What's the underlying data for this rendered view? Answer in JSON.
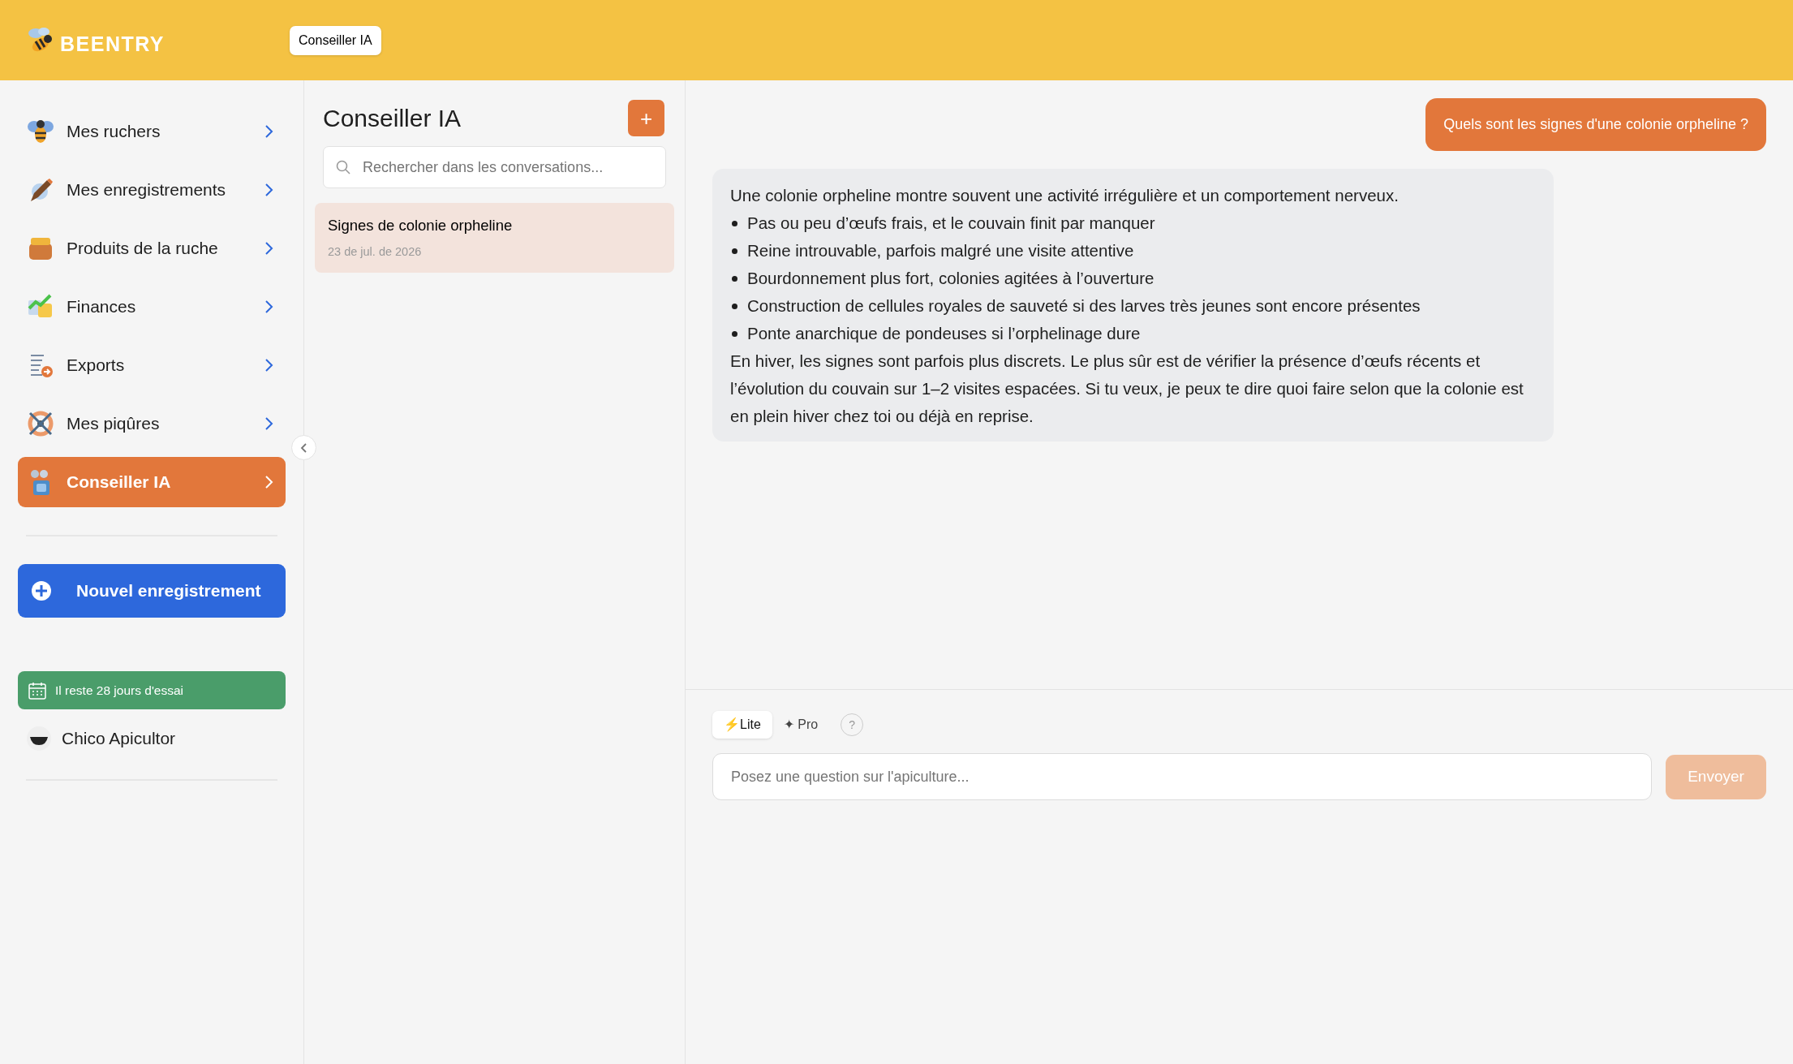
{
  "header": {
    "brand": "BEENTRY",
    "page_pill": "Conseiller IA"
  },
  "sidebar": {
    "items": [
      {
        "label": "Mes ruchers",
        "selected": false
      },
      {
        "label": "Mes enregistrements",
        "selected": false
      },
      {
        "label": "Produits de la ruche",
        "selected": false
      },
      {
        "label": "Finances",
        "selected": false
      },
      {
        "label": "Exports",
        "selected": false
      },
      {
        "label": "Mes piqûres",
        "selected": false
      },
      {
        "label": "Conseiller IA",
        "selected": true
      }
    ],
    "new_button": "Nouvel enregistrement",
    "trial": "Il reste 28 jours d'essai",
    "user": "Chico Apicultor"
  },
  "conversations": {
    "title": "Conseiller IA",
    "add_button": "+",
    "search": {
      "placeholder": "Rechercher dans les conversations..."
    },
    "items": [
      {
        "title": "Signes de colonie orpheline",
        "date": "23 de jul. de 2026",
        "selected": true
      }
    ]
  },
  "chat": {
    "messages": [
      {
        "kind": "user",
        "text": "Quels sont les signes d'une colonie orpheline ?"
      },
      {
        "kind": "assistant",
        "intro": "Une colonie orpheline montre souvent une activité irrégulière et un comportement nerveux.",
        "bullets": [
          "Pas ou peu d’œufs frais, et le couvain finit par manquer",
          "Reine introuvable, parfois malgré une visite attentive",
          "Bourdonnement plus fort, colonies agitées à l’ouverture",
          "Construction de cellules royales de sauveté si des larves très jeunes sont encore présentes",
          "Ponte anarchique de pondeuses si l’orphelinage dure"
        ],
        "outro": "En hiver, les signes sont parfois plus discrets. Le plus sûr est de vérifier la présence d’œufs récents et l’évolution du couvain sur 1–2 visites espacées. Si tu veux, je peux te dire quoi faire selon que la colonie est en plein hiver chez toi ou déjà en reprise."
      }
    ],
    "modes": [
      {
        "label": "⚡Lite",
        "selected": true
      },
      {
        "label": "✦ Pro",
        "selected": false
      }
    ],
    "help": "?",
    "input": {
      "placeholder": "Posez une question sur l'apiculture..."
    },
    "send": {
      "label": "Envoyer",
      "disabled": true
    }
  }
}
